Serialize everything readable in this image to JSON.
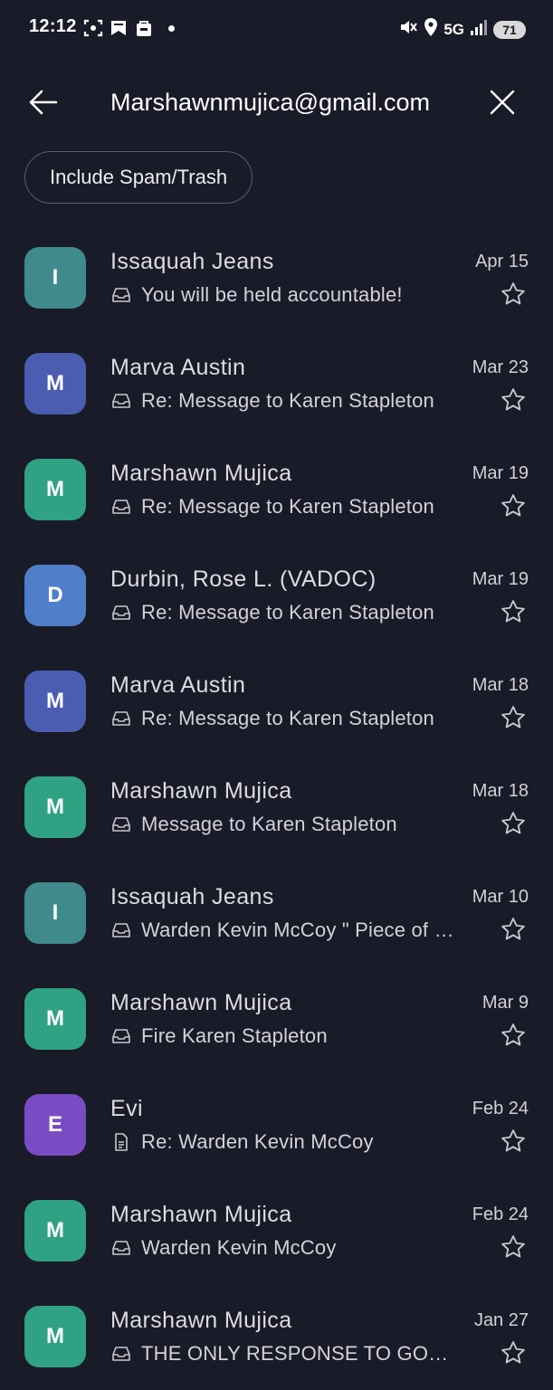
{
  "status_bar": {
    "time": "12:12",
    "network": "5G",
    "battery": "71"
  },
  "header": {
    "query": "Marshawnmujica@gmail.com"
  },
  "filter_chip": {
    "label": "Include Spam/Trash"
  },
  "emails": [
    {
      "initial": "I",
      "color": "#3f8a8c",
      "sender": "Issaquah Jeans",
      "date": "Apr 15",
      "icon": "inbox-icon",
      "subject": "You will be held accountable!"
    },
    {
      "initial": "M",
      "color": "#4a5db0",
      "sender": "Marva Austin",
      "date": "Mar 23",
      "icon": "inbox-icon",
      "subject": "Re: Message to Karen Stapleton"
    },
    {
      "initial": "M",
      "color": "#2fa283",
      "sender": "Marshawn Mujica",
      "date": "Mar 19",
      "icon": "inbox-icon",
      "subject": "Re: Message to Karen Stapleton"
    },
    {
      "initial": "D",
      "color": "#4f7fc8",
      "sender": "Durbin, Rose L. (VADOC)",
      "date": "Mar 19",
      "icon": "inbox-icon",
      "subject": "Re: Message to Karen Stapleton"
    },
    {
      "initial": "M",
      "color": "#4a5db0",
      "sender": "Marva Austin",
      "date": "Mar 18",
      "icon": "inbox-icon",
      "subject": "Re: Message to Karen Stapleton"
    },
    {
      "initial": "M",
      "color": "#2fa283",
      "sender": "Marshawn Mujica",
      "date": "Mar 18",
      "icon": "inbox-icon",
      "subject": "Message to Karen Stapleton"
    },
    {
      "initial": "I",
      "color": "#3f8a8c",
      "sender": "Issaquah Jeans",
      "date": "Mar 10",
      "icon": "inbox-icon",
      "subject": "Warden Kevin McCoy \" Piece of work \""
    },
    {
      "initial": "M",
      "color": "#2fa283",
      "sender": "Marshawn Mujica",
      "date": "Mar 9",
      "icon": "inbox-icon",
      "subject": "Fire Karen Stapleton"
    },
    {
      "initial": "E",
      "color": "#7a4cc4",
      "sender": "Evi",
      "date": "Feb 24",
      "icon": "draft-icon",
      "subject": "Re: Warden Kevin McCoy"
    },
    {
      "initial": "M",
      "color": "#2fa283",
      "sender": "Marshawn Mujica",
      "date": "Feb 24",
      "icon": "inbox-icon",
      "subject": "Warden Kevin McCoy"
    },
    {
      "initial": "M",
      "color": "#2fa283",
      "sender": "Marshawn Mujica",
      "date": "Jan 27",
      "icon": "inbox-icon",
      "subject": "THE ONLY RESPONSE TO GOV. YOUNGKIN"
    }
  ]
}
